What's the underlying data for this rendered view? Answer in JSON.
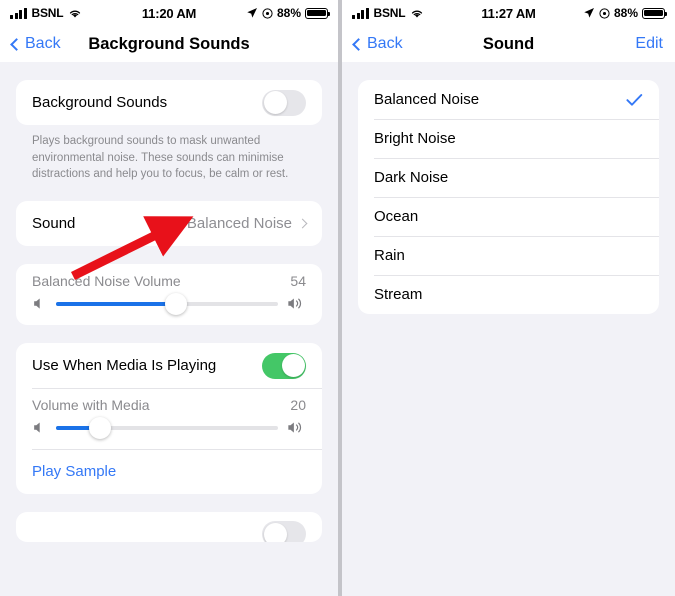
{
  "left": {
    "status": {
      "carrier": "BSNL",
      "time": "11:20 AM",
      "battery": "88%",
      "signal_icon": "cellular-bars-icon",
      "wifi_icon": "wifi-icon",
      "location_icon": "location-arrow-icon",
      "focus_icon": "focus-circle-icon",
      "battery_icon": "battery-full-icon"
    },
    "nav": {
      "back": "Back",
      "title": "Background Sounds"
    },
    "background_sounds": {
      "label": "Background Sounds",
      "enabled": false,
      "footnote": "Plays background sounds to mask unwanted environmental noise. These sounds can minimise distractions and help you to focus, be calm or rest."
    },
    "sound_row": {
      "label": "Sound",
      "value": "Balanced Noise"
    },
    "volume_slider": {
      "label": "Balanced Noise Volume",
      "value": "54",
      "percent": 54,
      "min_icon": "speaker-low-icon",
      "max_icon": "speaker-high-icon"
    },
    "media": {
      "label": "Use When Media Is Playing",
      "enabled": true
    },
    "media_slider": {
      "label": "Volume with Media",
      "value": "20",
      "percent": 20,
      "min_icon": "speaker-low-icon",
      "max_icon": "speaker-high-icon"
    },
    "play_sample": "Play Sample",
    "partial_card": {
      "enabled": false
    }
  },
  "right": {
    "status": {
      "carrier": "BSNL",
      "time": "11:27 AM",
      "battery": "88%"
    },
    "nav": {
      "back": "Back",
      "title": "Sound",
      "edit": "Edit"
    },
    "sounds": [
      {
        "label": "Balanced Noise",
        "selected": true
      },
      {
        "label": "Bright Noise",
        "selected": false
      },
      {
        "label": "Dark Noise",
        "selected": false
      },
      {
        "label": "Ocean",
        "selected": false
      },
      {
        "label": "Rain",
        "selected": false
      },
      {
        "label": "Stream",
        "selected": false
      }
    ]
  },
  "annotation": {
    "arrow_color": "#e8111a",
    "arrow_name": "red-pointer-arrow"
  },
  "colors": {
    "accent_blue": "#3478f6",
    "slider_blue": "#1a72e8",
    "toggle_green": "#44c767",
    "page_bg": "#f2f2f7"
  }
}
